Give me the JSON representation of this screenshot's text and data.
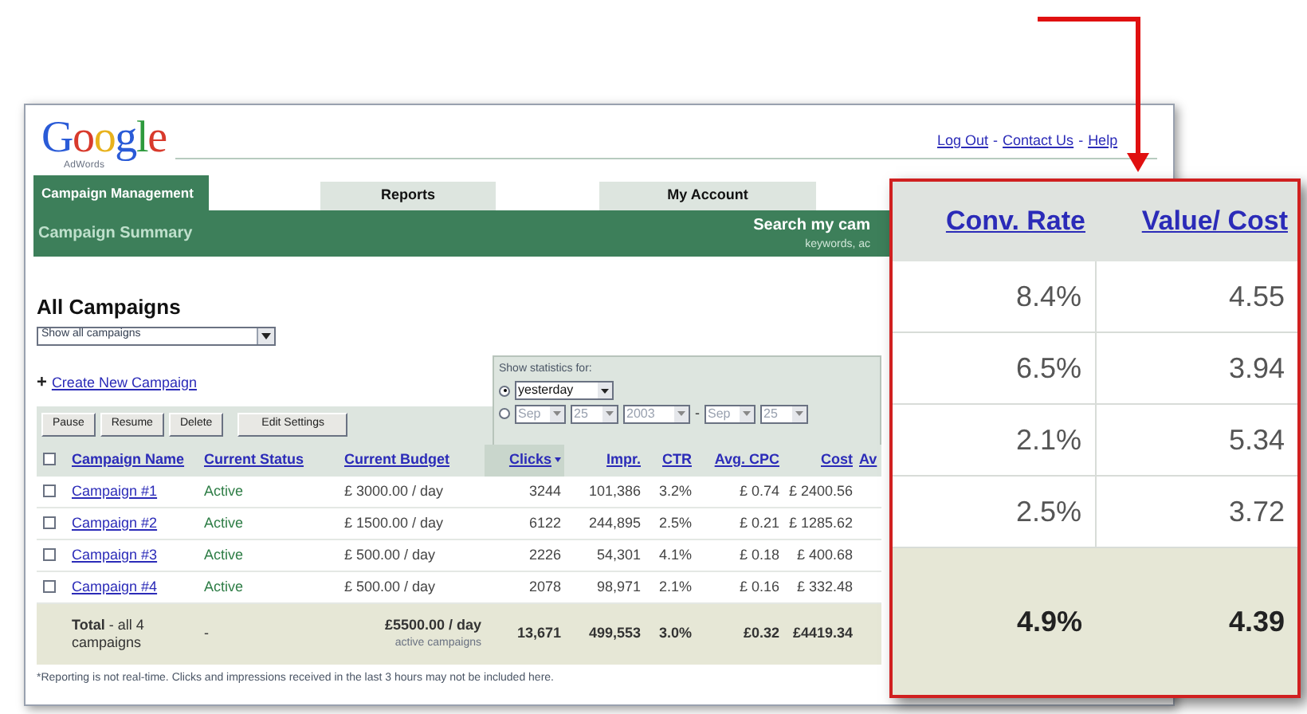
{
  "logo": {
    "wordmark": "Google",
    "product": "AdWords"
  },
  "header_links": {
    "items": [
      "Log Out",
      "Contact Us",
      "Help"
    ],
    "separator": "-"
  },
  "tabs": [
    {
      "label": "Campaign Management",
      "selected": true
    },
    {
      "label": "Reports",
      "selected": false
    },
    {
      "label": "My Account",
      "selected": false
    }
  ],
  "subnav": {
    "title": "Campaign Summary",
    "search_label": "Search my cam",
    "search_hint": "keywords, ac"
  },
  "section_title": "All Campaigns",
  "filter_select": "Show all campaigns",
  "create_link": {
    "icon": "+",
    "label": "Create New Campaign"
  },
  "buttons": [
    "Pause",
    "Resume",
    "Delete",
    "Edit Settings"
  ],
  "stats_panel": {
    "title": "Show statistics for:",
    "options": [
      {
        "kind": "preset",
        "selected": true,
        "value": "yesterday"
      },
      {
        "kind": "range",
        "selected": false,
        "from": [
          "Sep",
          "25",
          "2003"
        ],
        "separator": "-",
        "to": [
          "Sep",
          "25"
        ]
      }
    ]
  },
  "table": {
    "select_all_checked": false,
    "columns": [
      {
        "label": "Campaign Name",
        "sorted": false
      },
      {
        "label": "Current Status",
        "sorted": false
      },
      {
        "label": "Current Budget",
        "sorted": false
      },
      {
        "label": "Clicks",
        "sorted": true
      },
      {
        "label": "Impr.",
        "sorted": false
      },
      {
        "label": "CTR",
        "sorted": false
      },
      {
        "label": "Avg. CPC",
        "sorted": false
      },
      {
        "label": "Cost",
        "sorted": false
      },
      {
        "label": "Av",
        "sorted": false
      }
    ],
    "rows": [
      {
        "checked": false,
        "cells": [
          "Campaign #1",
          "Active",
          "£ 3000.00 / day",
          "3244",
          "101,386",
          "3.2%",
          "£ 0.74",
          "£ 2400.56"
        ]
      },
      {
        "checked": false,
        "cells": [
          "Campaign #2",
          "Active",
          "£ 1500.00 / day",
          "6122",
          "244,895",
          "2.5%",
          "£ 0.21",
          "£ 1285.62"
        ]
      },
      {
        "checked": false,
        "cells": [
          "Campaign #3",
          "Active",
          "£ 500.00 / day",
          "2226",
          "54,301",
          "4.1%",
          "£ 0.18",
          "£ 400.68"
        ]
      },
      {
        "checked": false,
        "cells": [
          "Campaign #4",
          "Active",
          "£ 500.00 / day",
          "2078",
          "98,971",
          "2.1%",
          "£ 0.16",
          "£ 332.48"
        ]
      }
    ],
    "total": {
      "label": "**Total** - all 4 campaigns",
      "status": "-",
      "budget": "£5500.00 / day",
      "budget_note": "active campaigns",
      "cells": [
        "13,671",
        "499,553",
        "3.0%",
        "£0.32",
        "£4419.34"
      ]
    }
  },
  "footnote": "*Reporting is not real-time. Clicks and impressions received in the last 3 hours may not be included here.",
  "callout": {
    "columns": [
      "Conv. Rate",
      "Value/ Cost"
    ],
    "rows": [
      [
        "8.4%",
        "4.55"
      ],
      [
        "6.5%",
        "3.94"
      ],
      [
        "2.1%",
        "5.34"
      ],
      [
        "2.5%",
        "3.72"
      ]
    ],
    "total": [
      "4.9%",
      "4.39"
    ]
  }
}
